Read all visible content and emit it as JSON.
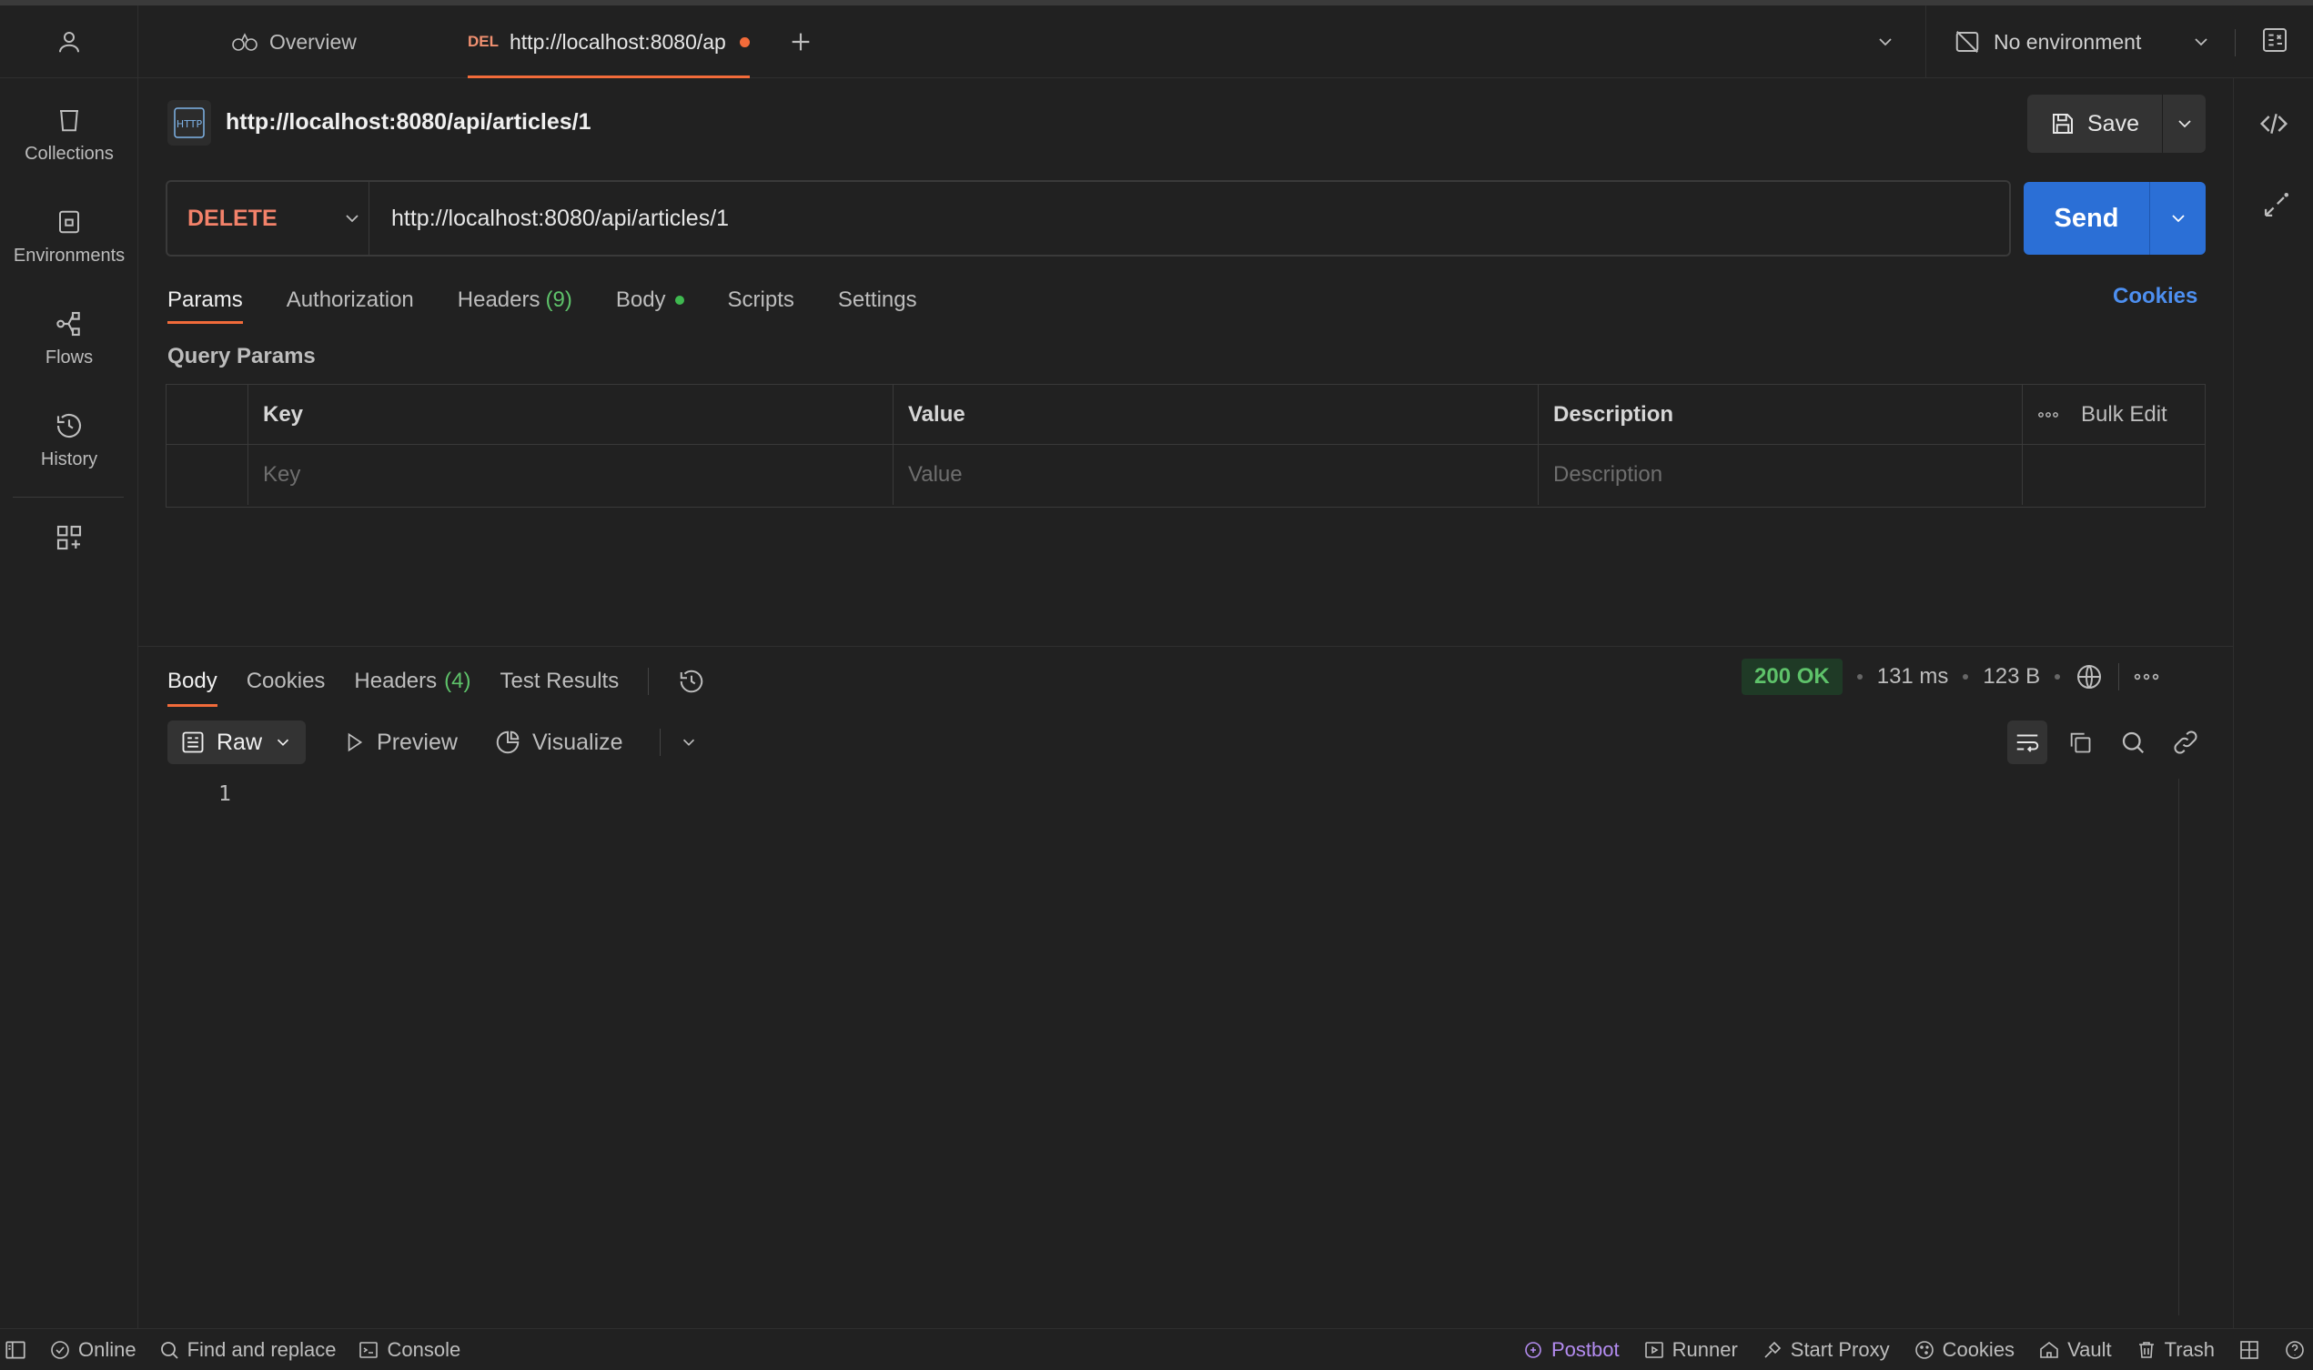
{
  "topbar": {
    "tabs": [
      {
        "label": "Overview"
      },
      {
        "method": "DEL",
        "label": "http://localhost:8080/ap"
      }
    ],
    "environment": "No environment"
  },
  "sidebar": {
    "items": [
      {
        "label": "Collections"
      },
      {
        "label": "Environments"
      },
      {
        "label": "Flows"
      },
      {
        "label": "History"
      }
    ]
  },
  "request": {
    "title": "http://localhost:8080/api/articles/1",
    "title_icon_text": "HTTP",
    "save_label": "Save",
    "method": "DELETE",
    "url": "http://localhost:8080/api/articles/1",
    "send_label": "Send",
    "tabs": {
      "params": "Params",
      "authorization": "Authorization",
      "headers": "Headers",
      "headers_count": "(9)",
      "body": "Body",
      "scripts": "Scripts",
      "settings": "Settings"
    },
    "cookies_link": "Cookies",
    "query_params": {
      "label": "Query Params",
      "columns": [
        "Key",
        "Value",
        "Description"
      ],
      "bulk_edit": "Bulk Edit",
      "placeholders": [
        "Key",
        "Value",
        "Description"
      ]
    }
  },
  "response": {
    "tabs": {
      "body": "Body",
      "cookies": "Cookies",
      "headers": "Headers",
      "headers_count": "(4)",
      "test_results": "Test Results"
    },
    "status": "200 OK",
    "time": "131 ms",
    "size": "123 B",
    "format": "Raw",
    "preview": "Preview",
    "visualize": "Visualize",
    "line_number": "1"
  },
  "statusbar": {
    "online": "Online",
    "find_replace": "Find and replace",
    "console": "Console",
    "postbot": "Postbot",
    "runner": "Runner",
    "start_proxy": "Start Proxy",
    "cookies": "Cookies",
    "vault": "Vault",
    "trash": "Trash"
  },
  "colors": {
    "accent_orange": "#f26b3a",
    "send_blue": "#2b6fd6",
    "method_delete": "#f3826a",
    "success_green": "#5ec26a",
    "postbot_purple": "#b48cf0"
  }
}
